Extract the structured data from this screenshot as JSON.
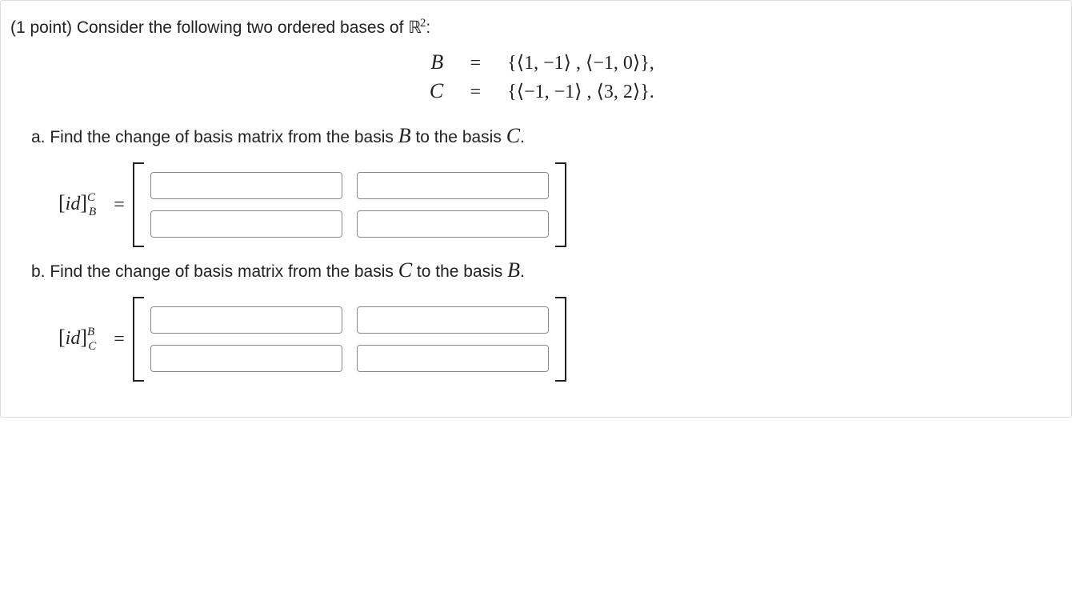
{
  "intro": {
    "points_text": "(1 point) ",
    "lead_text": "Consider the following two ordered bases of ",
    "space_text": "ℝ",
    "exponent": "2",
    "colon": ":"
  },
  "basis_definitions": {
    "B_symbol": "B",
    "C_symbol": "C",
    "equals": "=",
    "B_value": "{⟨1, −1⟩ , ⟨−1, 0⟩},",
    "C_value": "{⟨−1, −1⟩ , ⟨3, 2⟩}."
  },
  "part_a": {
    "label_prefix": "a. Find the change of basis matrix from the basis ",
    "from_basis": "B",
    "mid_text": " to the basis ",
    "to_basis": "C",
    "period": ".",
    "id_text": "id",
    "sup": "C",
    "sub": "B",
    "cells": {
      "r1c1": "",
      "r1c2": "",
      "r2c1": "",
      "r2c2": ""
    }
  },
  "part_b": {
    "label_prefix": "b. Find the change of basis matrix from the basis ",
    "from_basis": "C",
    "mid_text": " to the basis ",
    "to_basis": "B",
    "period": ".",
    "id_text": "id",
    "sup": "B",
    "sub": "C",
    "cells": {
      "r1c1": "",
      "r1c2": "",
      "r2c1": "",
      "r2c2": ""
    }
  }
}
